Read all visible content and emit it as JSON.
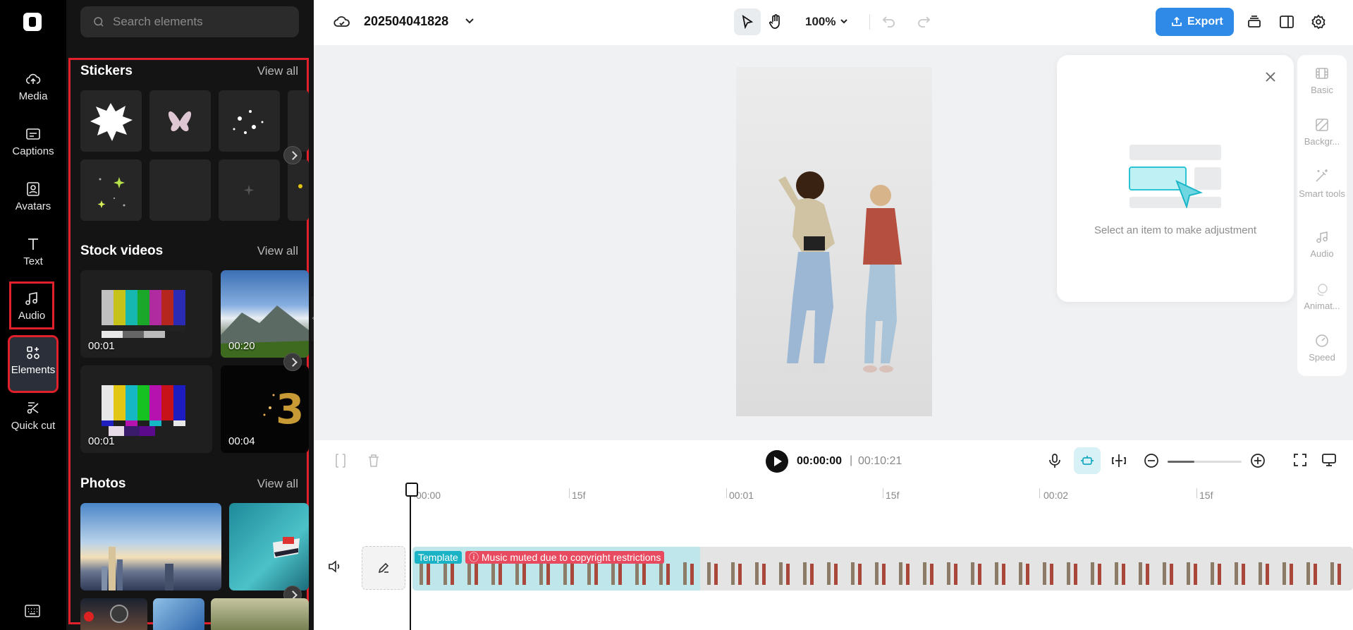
{
  "rail": {
    "items": [
      {
        "label": "Media"
      },
      {
        "label": "Captions"
      },
      {
        "label": "Avatars"
      },
      {
        "label": "Text"
      },
      {
        "label": "Audio"
      },
      {
        "label": "Elements"
      },
      {
        "label": "Quick cut"
      }
    ]
  },
  "panel": {
    "search_placeholder": "Search elements",
    "stickers": {
      "title": "Stickers",
      "view_all": "View all"
    },
    "stock_videos": {
      "title": "Stock videos",
      "view_all": "View all",
      "items": [
        {
          "duration": "00:01"
        },
        {
          "duration": "00:20"
        },
        {
          "duration": "00:01"
        },
        {
          "duration": "00:04"
        }
      ]
    },
    "photos": {
      "title": "Photos",
      "view_all": "View all"
    }
  },
  "topbar": {
    "project_name": "202504041828",
    "zoom": "100%",
    "export_label": "Export"
  },
  "adjust": {
    "message": "Select an item to make adjustment"
  },
  "properties": {
    "items": [
      {
        "label": "Basic"
      },
      {
        "label": "Backgr..."
      },
      {
        "label": "Smart tools"
      },
      {
        "label": "Audio"
      },
      {
        "label": "Animat..."
      },
      {
        "label": "Speed"
      }
    ]
  },
  "playback": {
    "current_time": "00:00:00",
    "separator": "|",
    "total_time": "00:10:21",
    "zoom_level": 0.36
  },
  "timeline": {
    "ruler": [
      "00:00",
      "15f",
      "00:01",
      "15f",
      "00:02",
      "15f"
    ],
    "clip": {
      "template_tag": "Template",
      "muted_notice": "Music muted due to copyright restrictions"
    }
  },
  "colors": {
    "accent": "#2e8ae6",
    "highlight_box": "#e0202a",
    "template_tag": "#19b3c5",
    "muted_tag": "#e84a5f"
  }
}
